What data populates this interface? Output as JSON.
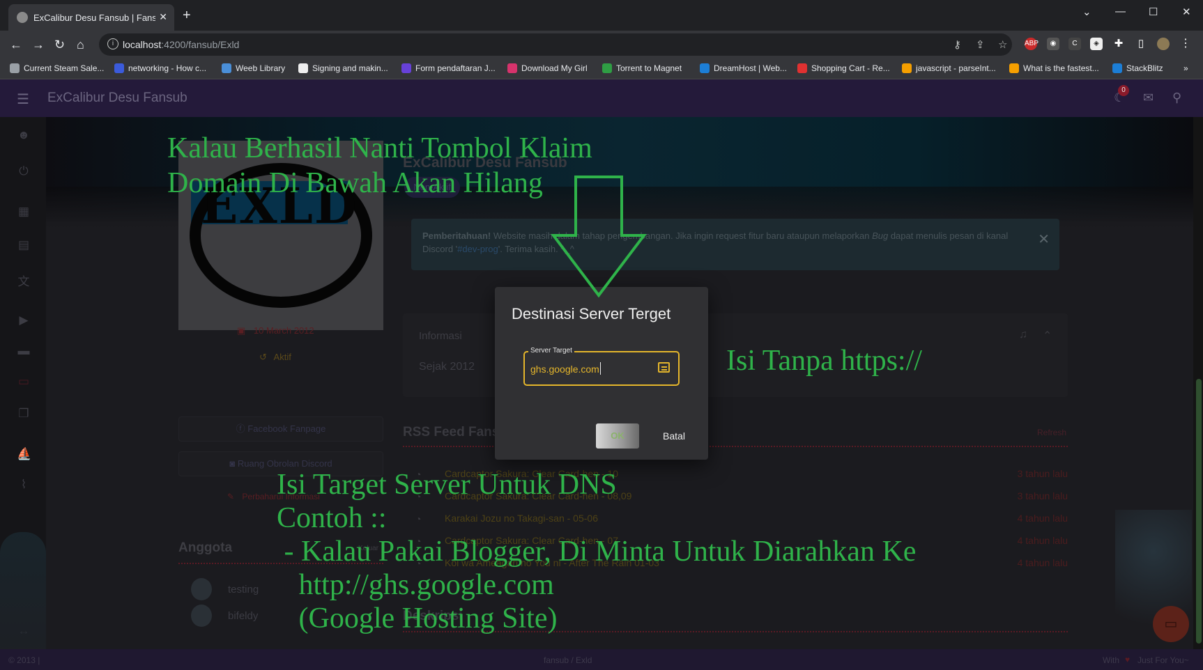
{
  "browser": {
    "tab_title": "ExCalibur Desu Fansub | FansubID",
    "tab_close": "✕",
    "new_tab": "+",
    "url_host": "localhost",
    "url_path": ":4200/fansub/Exld",
    "window_controls": {
      "minimize": "—",
      "maximize": "☐",
      "close": "✕",
      "dropdown": "⌄"
    },
    "bookmarks": [
      {
        "label": "Current Steam Sale...",
        "color": "#9aa0a6"
      },
      {
        "label": "networking - How c...",
        "color": "#3b5bdb"
      },
      {
        "label": "Weeb Library",
        "color": "#4a8fd8"
      },
      {
        "label": "Signing and makin...",
        "color": "#eeeeee"
      },
      {
        "label": "Form pendaftaran J...",
        "color": "#6741d9"
      },
      {
        "label": "Download My Girl",
        "color": "#d6336c"
      },
      {
        "label": "Torrent to Magnet",
        "color": "#2f9e44"
      },
      {
        "label": "DreamHost | Web...",
        "color": "#1c7ed6"
      },
      {
        "label": "Shopping Cart - Re...",
        "color": "#e03131"
      },
      {
        "label": "javascript - parseInt...",
        "color": "#f59f00"
      },
      {
        "label": "What is the fastest...",
        "color": "#f59f00"
      },
      {
        "label": "StackBlitz",
        "color": "#1c7ed6"
      }
    ],
    "more_bookmarks": "»"
  },
  "app": {
    "title": "ExCalibur Desu Fansub",
    "notif_count": "0",
    "logo_text": "EXLD",
    "fansub_name": "ExCalibur Desu Fansub",
    "status_chip": "Non-Aktif",
    "born_date": "10 March 2012",
    "active_status": "Aktif",
    "links": {
      "facebook": "Facebook Fanpage",
      "discord": "Ruang Obrolan Discord",
      "update": "Perbaharui Informasi"
    },
    "alert": {
      "bold": "Pemberitahuan!",
      "text1": " Website masih dalam tahap pengembangan. Jika ingin request fitur baru ataupun melaporkan ",
      "bug": "Bug",
      "text2": " dapat menulis pesan di kanal Discord '",
      "channel": "#dev-prog",
      "text3": "'. Terima kasih. ^_^",
      "close": "✕"
    },
    "info": {
      "header": "Informasi",
      "since": "Sejak 2012"
    },
    "rss": {
      "title": "RSS Feed Fansub",
      "refresh": "Refresh",
      "items": [
        {
          "title": "Cardcaptor Sakura: Clear Card-hen - 10",
          "time": "3 tahun lalu"
        },
        {
          "title": "Cardcaptor Sakura: Clear Card-hen - 08,09",
          "time": "3 tahun lalu"
        },
        {
          "title": "Karakai Jozu no Takagi-san - 05-06",
          "time": "4 tahun lalu"
        },
        {
          "title": "Cardcaptor Sakura: Clear Card-hen - 07",
          "time": "4 tahun lalu"
        },
        {
          "title": "Koi wa Ameagari no You ni - After The Rain 01-03",
          "time": "4 tahun lalu"
        }
      ]
    },
    "members": {
      "title": "Anggota",
      "leave": "Keluar",
      "list": [
        "testing",
        "bifeldy"
      ]
    },
    "about_title": "Deskripsi",
    "footer": {
      "left": "© 2013 |",
      "center": "fansub / Exld",
      "with": "With",
      "right": "Just For You~"
    }
  },
  "modal": {
    "title": "Destinasi Server Terget",
    "field_label": "Server Target",
    "field_value": "ghs.google.com",
    "ok": "OK",
    "cancel": "Batal"
  },
  "annotations": {
    "top": [
      "Kalau Berhasil Nanti Tombol Klaim",
      "Domain Di Bawah Akan Hilang"
    ],
    "right": "Isi Tanpa https://",
    "bottom": [
      "Isi Target Server Untuk DNS",
      "Contoh ::",
      " - Kalau Pakai Blogger, Di Minta Untuk Diarahkan Ke",
      "   http://ghs.google.com",
      "   (Google Hosting Site)"
    ],
    "color": "#2fb34a"
  }
}
